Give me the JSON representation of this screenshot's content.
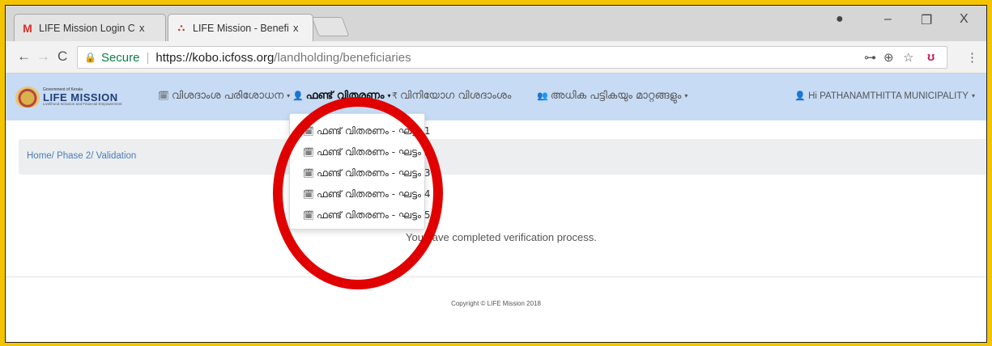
{
  "browser": {
    "tabs": [
      {
        "title": "LIFE Mission Login Crede",
        "icon": "gmail-icon",
        "close": "x"
      },
      {
        "title": "LIFE Mission - Beneficiari",
        "icon": "life-mission-favicon",
        "close": "x"
      }
    ],
    "window_controls": {
      "account": "●",
      "minimize": "–",
      "restore": "❐",
      "close": "X"
    },
    "nav": {
      "back": "←",
      "forward": "→",
      "reload": "C"
    },
    "address": {
      "secure_label": "Secure",
      "separator": "|",
      "url_host": "https://kobo.icfoss.org",
      "url_path": "/landholding/beneficiaries"
    },
    "right_icons": {
      "key": "⊶",
      "zoom": "⊕",
      "star": "☆",
      "ext": "ʊ",
      "menu": "⋮"
    }
  },
  "app": {
    "logo": {
      "gov": "Government of Kerala",
      "name": "LIFE MISSION",
      "tagline": "Livelihood Inclusion and Financial Empowerment"
    },
    "menus": [
      {
        "icon": "🗓",
        "label": "വിശദാംശ പരിശോധന",
        "caret": "▾"
      },
      {
        "icon": "👤",
        "label": "ഫണ്ട് വിതരണം",
        "caret": "▾"
      },
      {
        "icon": "₹",
        "label": "വിനിയോഗ വിശദാംശം",
        "caret": ""
      },
      {
        "icon": "👥",
        "label": "അധിക പട്ടികയും മാറ്റങ്ങളും",
        "caret": "▾"
      }
    ],
    "user": {
      "icon": "👤",
      "label": "Hi PATHANAMTHITTA MUNICIPALITY",
      "caret": "▾"
    }
  },
  "breadcrumb": "Home/ Phase 2/ Validation",
  "dropdown": {
    "items": [
      {
        "icon": "🗓",
        "label": "ഫണ്ട് വിതരണം - ഘട്ടം 1"
      },
      {
        "icon": "🗓",
        "label": "ഫണ്ട് വിതരണം - ഘട്ടം 2"
      },
      {
        "icon": "🗓",
        "label": "ഫണ്ട് വിതരണം - ഘട്ടം 3"
      },
      {
        "icon": "🗓",
        "label": "ഫണ്ട് വിതരണം - ഘട്ടം 4"
      },
      {
        "icon": "🗓",
        "label": "ഫണ്ട് വിതരണം - ഘട്ടം 5"
      }
    ]
  },
  "message": "You have completed verification process.",
  "footer": "Copyright © LIFE Mission 2018",
  "colors": {
    "outer_border": "#f5c400",
    "nav_bg": "#c7dbf4",
    "annotation": "#e00000",
    "link": "#4a7cb8"
  }
}
